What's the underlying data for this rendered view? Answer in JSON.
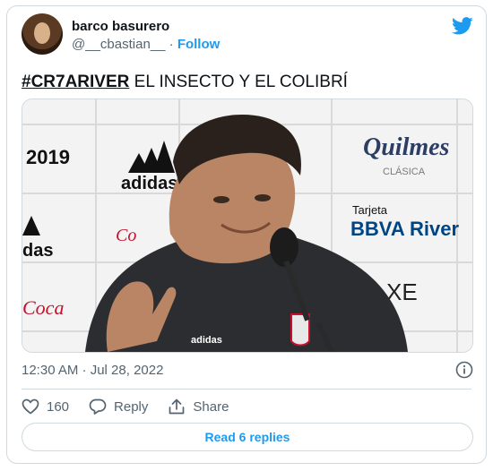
{
  "author": {
    "display_name": "barco basurero",
    "handle": "@__cbastian__",
    "separator": "·",
    "follow_label": "Follow"
  },
  "tweet": {
    "hashtag": "#CR7ARIVER",
    "text": " EL INSECTO Y EL COLIBRÍ"
  },
  "media": {
    "backdrop_text": {
      "top_left": "2019",
      "adidas": "adidas",
      "quilmes": "Quilmes",
      "quilmes_sub": "CLÁSICA",
      "tarjeta": "Tarjeta",
      "bbva": "BBVA River",
      "coca": "Coca",
      "xe": "XE",
      "das": "das"
    }
  },
  "meta": {
    "timestamp": "12:30 AM · Jul 28, 2022"
  },
  "actions": {
    "likes_count": "160",
    "reply_label": "Reply",
    "share_label": "Share"
  },
  "read_replies_label": "Read 6 replies",
  "colors": {
    "accent": "#1d9bf0",
    "text": "#0f1419",
    "muted": "#536471",
    "border": "#cfd9de"
  },
  "icons": [
    "twitter-bird-icon",
    "info-icon",
    "heart-icon",
    "reply-icon",
    "share-icon"
  ]
}
